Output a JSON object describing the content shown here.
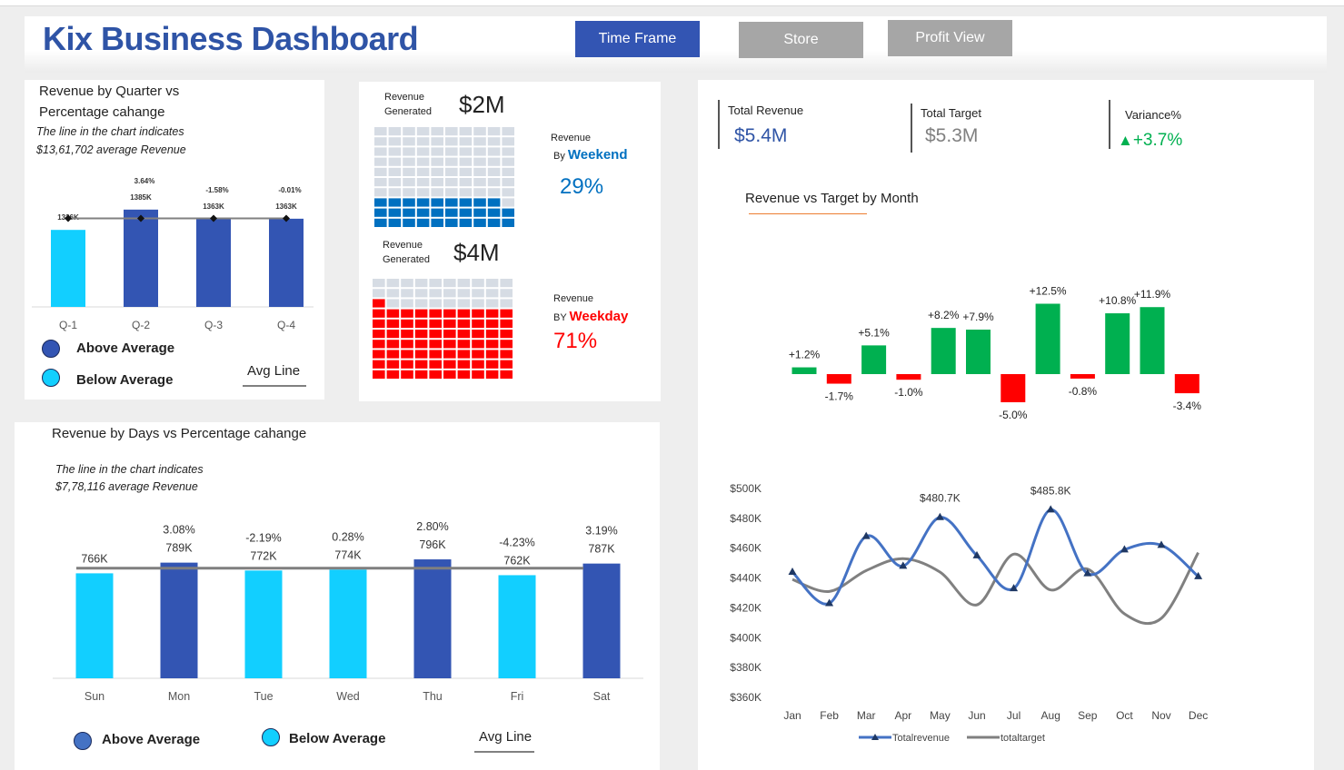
{
  "header": {
    "title": "Kix Business Dashboard",
    "buttons": [
      {
        "label": "Time Frame",
        "color": "#3355b3"
      },
      {
        "label": "Store",
        "color": "#a6a6a6"
      },
      {
        "label": "Profit View",
        "color": "#a6a6a6"
      }
    ]
  },
  "quarter_panel": {
    "title_line1": "Revenue by Quarter vs",
    "title_line2": "Percentage cahange",
    "note_line1": "The line in the chart indicates",
    "note_line2": "$13,61,702 average Revenue",
    "legend_above": "Above Average",
    "legend_below": "Below Average",
    "legend_avg": "Avg Line"
  },
  "waffle_panel": {
    "weekend_rev_label1": "Revenue",
    "weekend_rev_label2": "Generated",
    "weekend_value": "$2M",
    "weekend_cat_label1": "Revenue",
    "weekend_cat_prefix": "By",
    "weekend_cat_name": "Weekend",
    "weekend_pct": "29%",
    "weekday_rev_label1": "Revenue",
    "weekday_rev_label2": "Generated",
    "weekday_value": "$4M",
    "weekday_cat_label1": "Revenue",
    "weekday_cat_prefix": "BY",
    "weekday_cat_name": "Weekday",
    "weekday_pct": "71%"
  },
  "days_panel": {
    "title": "Revenue by Days vs  Percentage cahange",
    "note_line1": "The line in the chart indicates",
    "note_line2": "$7,78,116 average Revenue",
    "legend_above": "Above Average",
    "legend_below": "Below Average",
    "legend_avg": "Avg Line"
  },
  "kpis": {
    "total_revenue_label": "Total  Revenue",
    "total_revenue_value": "$5.4M",
    "total_target_label": "Total  Target",
    "total_target_value": "$5.3M",
    "variance_label": "Variance%",
    "variance_value": "+3.7%",
    "variance_arrow": "up-triangle-icon"
  },
  "variance_chart_title": "Revenue vs Target by Month",
  "colors": {
    "above": "#3355b3",
    "below": "#12cfff",
    "positive": "#00b050",
    "negative": "#ff0000",
    "revenue_line": "#4472c4",
    "target_line": "#808080",
    "weekend": "#0070c0",
    "weekday": "#ff0000"
  },
  "chart_data": [
    {
      "type": "bar",
      "id": "quarter",
      "categories": [
        "Q-1",
        "Q-2",
        "Q-3",
        "Q-4"
      ],
      "values": [
        1336,
        1385,
        1363,
        1363
      ],
      "value_labels": [
        "1336K",
        "1385K",
        "1363K",
        "1363K"
      ],
      "pct_labels": [
        "",
        "3.64%",
        "-1.58%",
        "-0.01%"
      ],
      "above_average": [
        false,
        true,
        true,
        true
      ],
      "average_line": 1361.7,
      "ylim": [
        0,
        1400
      ]
    },
    {
      "type": "bar",
      "id": "waffle",
      "series": [
        {
          "name": "Weekend",
          "percent": 29,
          "filled_cells": 29
        },
        {
          "name": "Weekday",
          "percent": 71,
          "filled_cells": 71
        }
      ]
    },
    {
      "type": "bar",
      "id": "days",
      "categories": [
        "Sun",
        "Mon",
        "Tue",
        "Wed",
        "Thu",
        "Fri",
        "Sat"
      ],
      "values": [
        766,
        789,
        772,
        774,
        796,
        762,
        787
      ],
      "value_labels": [
        "766K",
        "789K",
        "772K",
        "774K",
        "796K",
        "762K",
        "787K"
      ],
      "pct_labels": [
        "",
        "3.08%",
        "-2.19%",
        "0.28%",
        "2.80%",
        "-4.23%",
        "3.19%"
      ],
      "above_average": [
        false,
        true,
        false,
        false,
        true,
        false,
        true
      ],
      "average_line": 778.1,
      "ylim": [
        0,
        800
      ]
    },
    {
      "type": "bar",
      "id": "variance",
      "categories": [
        "Jan",
        "Feb",
        "Mar",
        "Apr",
        "May",
        "Jun",
        "Jul",
        "Aug",
        "Sep",
        "Oct",
        "Nov",
        "Dec"
      ],
      "values": [
        1.2,
        -1.7,
        5.1,
        -1.0,
        8.2,
        7.9,
        -5.0,
        12.5,
        -0.8,
        10.8,
        11.9,
        -3.4
      ],
      "value_labels": [
        "+1.2%",
        "-1.7%",
        "+5.1%",
        "-1.0%",
        "+8.2%",
        "+7.9%",
        "-5.0%",
        "+12.5%",
        "-0.8%",
        "+10.8%",
        "+11.9%",
        "-3.4%"
      ]
    },
    {
      "type": "line",
      "id": "monthly",
      "categories": [
        "Jan",
        "Feb",
        "Mar",
        "Apr",
        "May",
        "Jun",
        "Jul",
        "Aug",
        "Sep",
        "Oct",
        "Nov",
        "Dec"
      ],
      "series": [
        {
          "name": "Totalrevenue",
          "values": [
            444,
            423,
            468,
            448,
            480.7,
            455,
            433,
            485.8,
            443,
            459,
            462,
            441
          ]
        },
        {
          "name": "totaltarget",
          "values": [
            439,
            431,
            445,
            453,
            444,
            422,
            456,
            432,
            446,
            416,
            413,
            457
          ]
        }
      ],
      "point_labels": [
        {
          "index": 4,
          "text": "$480.7K"
        },
        {
          "index": 7,
          "text": "$485.8K"
        }
      ],
      "yticks": [
        360,
        380,
        400,
        420,
        440,
        460,
        480,
        500
      ],
      "ytick_labels": [
        "$360K",
        "$380K",
        "$400K",
        "$420K",
        "$440K",
        "$460K",
        "$480K",
        "$500K"
      ],
      "ylim": [
        360,
        500
      ]
    }
  ]
}
